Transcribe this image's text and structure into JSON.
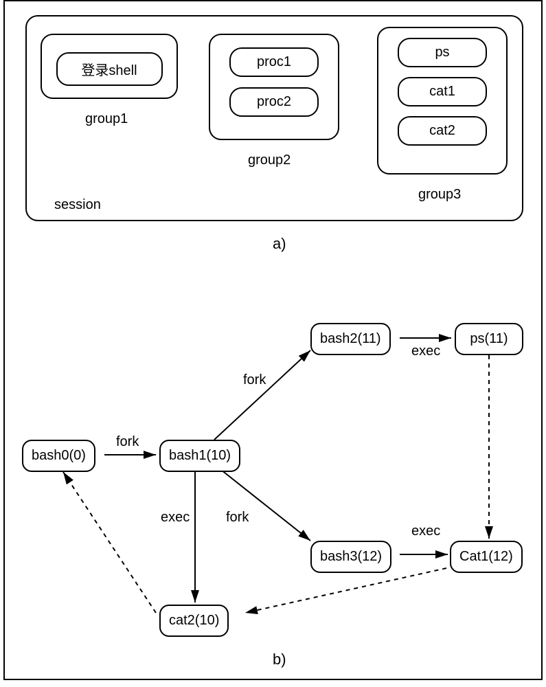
{
  "figure_labels": {
    "a": "a)",
    "b": "b)"
  },
  "session": {
    "label": "session",
    "group1": {
      "label": "group1",
      "procs": [
        "登录shell"
      ]
    },
    "group2": {
      "label": "group2",
      "procs": [
        "proc1",
        "proc2"
      ]
    },
    "group3": {
      "label": "group3",
      "procs": [
        "ps",
        "cat1",
        "cat2"
      ]
    }
  },
  "flow": {
    "nodes": {
      "bash0": "bash0(0)",
      "bash1": "bash1(10)",
      "bash2": "bash2(11)",
      "bash3": "bash3(12)",
      "ps": "ps(11)",
      "cat1": "Cat1(12)",
      "cat2": "cat2(10)"
    },
    "edges": {
      "bash0_bash1": "fork",
      "bash1_bash2": "fork",
      "bash1_bash3": "fork",
      "bash2_ps": "exec",
      "bash3_cat1": "exec",
      "bash1_cat2": "exec"
    }
  }
}
